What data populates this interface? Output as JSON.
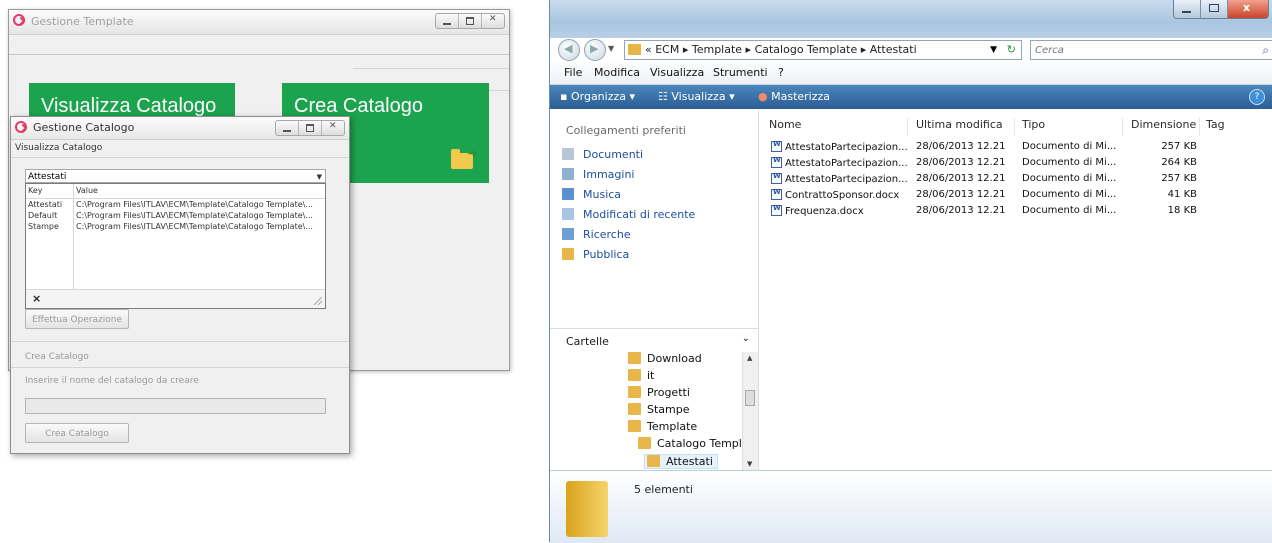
{
  "template_window": {
    "title": "Gestione Template",
    "tile_visualizza": "Visualizza Catalogo",
    "tile_crea": "Crea Catalogo"
  },
  "catalogo_window": {
    "title": "Gestione Catalogo",
    "section_visualizza": "Visualizza Catalogo",
    "combo_value": "Attestati",
    "dropdown": {
      "col_key": "Key",
      "col_value": "Value",
      "rows": [
        {
          "key": "Attestati",
          "value": "C:\\Program Files\\ITLAV\\ECM\\Template\\Catalogo Template\\..."
        },
        {
          "key": "Default",
          "value": "C:\\Program Files\\ITLAV\\ECM\\Template\\Catalogo Template\\..."
        },
        {
          "key": "Stampe",
          "value": "C:\\Program Files\\ITLAV\\ECM\\Template\\Catalogo Template\\..."
        }
      ],
      "clear": "×"
    },
    "btn_effettua": "Effettua Operazione",
    "section_crea": "Crea Catalogo",
    "crea_prompt": "Inserire il nome del catalogo da creare",
    "btn_crea": "Crea Catalogo"
  },
  "explorer": {
    "breadcrumb": "« ECM ▸ Template ▸ Catalogo Template ▸ Attestati",
    "search_placeholder": "Cerca",
    "menu": [
      "File",
      "Modifica",
      "Visualizza",
      "Strumenti",
      "?"
    ],
    "commands": {
      "organizza": "Organizza",
      "visualizza": "Visualizza",
      "masterizza": "Masterizza"
    },
    "favorites_header": "Collegamenti preferiti",
    "favorites": [
      "Documenti",
      "Immagini",
      "Musica",
      "Modificati di recente",
      "Ricerche",
      "Pubblica"
    ],
    "folders_header": "Cartelle",
    "tree": [
      "Download",
      "it",
      "Progetti",
      "Stampe",
      "Template",
      "Catalogo Templat",
      "Attestati"
    ],
    "columns": {
      "name": "Nome",
      "modified": "Ultima modifica",
      "type": "Tipo",
      "size": "Dimensione",
      "tag": "Tag"
    },
    "files": [
      {
        "name": "AttestatoPartecipazion...",
        "modified": "28/06/2013 12.21",
        "type": "Documento di Mi...",
        "size": "257 KB"
      },
      {
        "name": "AttestatoPartecipazion...",
        "modified": "28/06/2013 12.21",
        "type": "Documento di Mi...",
        "size": "264 KB"
      },
      {
        "name": "AttestatoPartecipazion...",
        "modified": "28/06/2013 12.21",
        "type": "Documento di Mi...",
        "size": "257 KB"
      },
      {
        "name": "ContrattoSponsor.docx",
        "modified": "28/06/2013 12.21",
        "type": "Documento di Mi...",
        "size": "41 KB"
      },
      {
        "name": "Frequenza.docx",
        "modified": "28/06/2013 12.21",
        "type": "Documento di Mi...",
        "size": "18 KB"
      }
    ],
    "item_count": "5 elementi"
  }
}
